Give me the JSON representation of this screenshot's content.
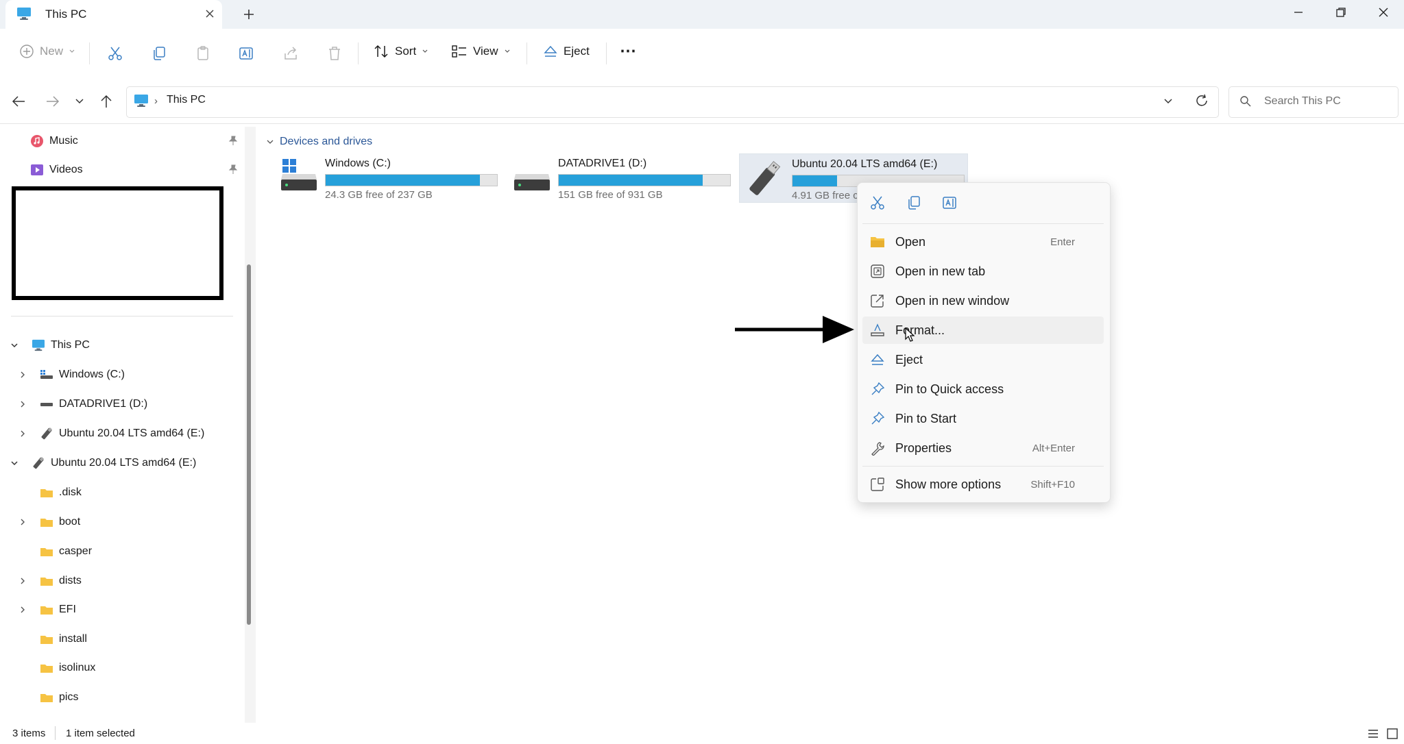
{
  "window": {
    "tab_title": "This PC",
    "new_tab_glyph": "+"
  },
  "toolbar": {
    "new_label": "New",
    "sort_label": "Sort",
    "view_label": "View",
    "eject_label": "Eject",
    "more_glyph": "⋯"
  },
  "address": {
    "location": "This PC",
    "search_placeholder": "Search This PC"
  },
  "sidebar": {
    "quick_access": [
      {
        "label": "Music",
        "icon": "music-icon"
      },
      {
        "label": "Videos",
        "icon": "videos-icon"
      }
    ],
    "tree": [
      {
        "label": "This PC",
        "icon": "pc-icon",
        "expanded": true
      },
      {
        "label": "Windows  (C:)",
        "icon": "drive-c-icon"
      },
      {
        "label": "DATADRIVE1 (D:)",
        "icon": "drive-d-icon"
      },
      {
        "label": "Ubuntu 20.04 LTS amd64 (E:)",
        "icon": "usb-drive-icon"
      },
      {
        "label": "Ubuntu 20.04 LTS amd64 (E:)",
        "icon": "usb-drive-icon",
        "expanded": true
      },
      {
        "label": ".disk",
        "icon": "folder-icon"
      },
      {
        "label": "boot",
        "icon": "folder-icon"
      },
      {
        "label": "casper",
        "icon": "folder-icon"
      },
      {
        "label": "dists",
        "icon": "folder-icon"
      },
      {
        "label": "EFI",
        "icon": "folder-icon"
      },
      {
        "label": "install",
        "icon": "folder-icon"
      },
      {
        "label": "isolinux",
        "icon": "folder-icon"
      },
      {
        "label": "pics",
        "icon": "folder-icon"
      }
    ]
  },
  "main": {
    "section_title": "Devices and drives",
    "drives": [
      {
        "name": "Windows  (C:)",
        "free": "24.3 GB free of 237 GB",
        "used_fraction": 0.9
      },
      {
        "name": "DATADRIVE1 (D:)",
        "free": "151 GB free of 931 GB",
        "used_fraction": 0.84
      },
      {
        "name": "Ubuntu 20.04 LTS amd64 (E:)",
        "free": "4.91 GB free c",
        "used_fraction": 0.26
      }
    ]
  },
  "context_menu": {
    "items": [
      {
        "label": "Open",
        "shortcut": "Enter",
        "icon": "folder-open-icon"
      },
      {
        "label": "Open in new tab",
        "shortcut": "",
        "icon": "new-tab-icon"
      },
      {
        "label": "Open in new window",
        "shortcut": "",
        "icon": "new-window-icon"
      },
      {
        "label": "Format...",
        "shortcut": "",
        "icon": "format-icon"
      },
      {
        "label": "Eject",
        "shortcut": "",
        "icon": "eject-icon"
      },
      {
        "label": "Pin to Quick access",
        "shortcut": "",
        "icon": "pin-icon"
      },
      {
        "label": "Pin to Start",
        "shortcut": "",
        "icon": "pin-icon"
      },
      {
        "label": "Properties",
        "shortcut": "Alt+Enter",
        "icon": "wrench-icon"
      },
      {
        "label": "Show more options",
        "shortcut": "Shift+F10",
        "icon": "more-options-icon"
      }
    ]
  },
  "status": {
    "items_count": "3 items",
    "selection": "1 item selected"
  },
  "colors": {
    "accent": "#26a0da",
    "folder": "#f6c343",
    "selection": "#e5eaf1"
  }
}
